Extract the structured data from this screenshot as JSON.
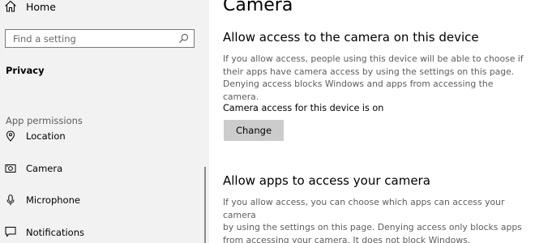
{
  "sidebar": {
    "home_label": "Home",
    "search_placeholder": "Find a setting",
    "privacy_heading": "Privacy",
    "section_label": "App permissions",
    "items": [
      {
        "label": "Location",
        "icon": "location-icon"
      },
      {
        "label": "Camera",
        "icon": "camera-icon"
      },
      {
        "label": "Microphone",
        "icon": "microphone-icon"
      },
      {
        "label": "Notifications",
        "icon": "notifications-icon"
      }
    ]
  },
  "main": {
    "title": "Camera",
    "device_section": {
      "heading": "Allow access to the camera on this device",
      "description_lines": [
        "If you allow access, people using this device will be able to choose if",
        "their apps have camera access by using the settings on this page.",
        "Denying access blocks Windows and apps from accessing the camera."
      ],
      "status": "Camera access for this device is on",
      "button_label": "Change"
    },
    "apps_section": {
      "heading": "Allow apps to access your camera",
      "description_lines": [
        "If you allow access, you can choose which apps can access your camera",
        "by using the settings on this page. Denying access only blocks apps",
        "from accessing your camera. It does not block Windows."
      ]
    }
  }
}
